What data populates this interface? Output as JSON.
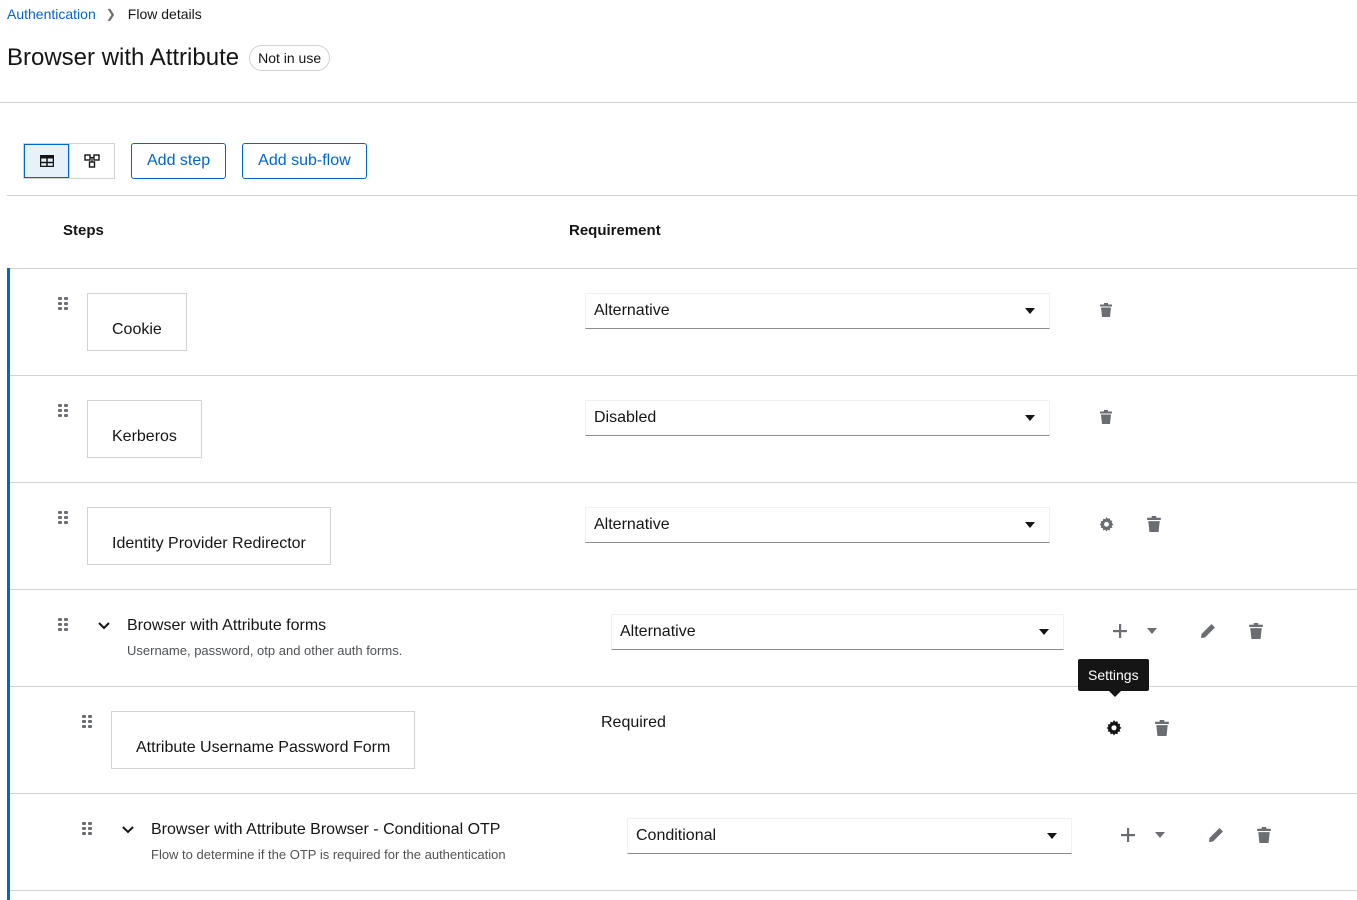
{
  "breadcrumb": {
    "parent": "Authentication",
    "current": "Flow details"
  },
  "page": {
    "title": "Browser with Attribute",
    "status_badge": "Not in use"
  },
  "toolbar": {
    "table_view_icon": "table-icon",
    "diagram_view_icon": "diagram-icon",
    "add_step": "Add step",
    "add_subflow": "Add sub-flow"
  },
  "columns": {
    "steps": "Steps",
    "requirement": "Requirement"
  },
  "rows": [
    {
      "name": "Cookie",
      "requirement": "Alternative"
    },
    {
      "name": "Kerberos",
      "requirement": "Disabled"
    },
    {
      "name": "Identity Provider Redirector",
      "requirement": "Alternative"
    },
    {
      "name": "Browser with Attribute forms",
      "description": "Username, password, otp and other auth forms.",
      "requirement": "Alternative"
    },
    {
      "name": "Attribute Username Password Form",
      "requirement": "Required"
    },
    {
      "name": "Browser with Attribute Browser - Conditional OTP",
      "description": "Flow to determine if the OTP is required for the authentication",
      "requirement": "Conditional"
    }
  ],
  "tooltip": {
    "text": "Settings"
  },
  "colors": {
    "accent": "#0066cc",
    "border": "#d2d2d2",
    "text": "#151515"
  }
}
